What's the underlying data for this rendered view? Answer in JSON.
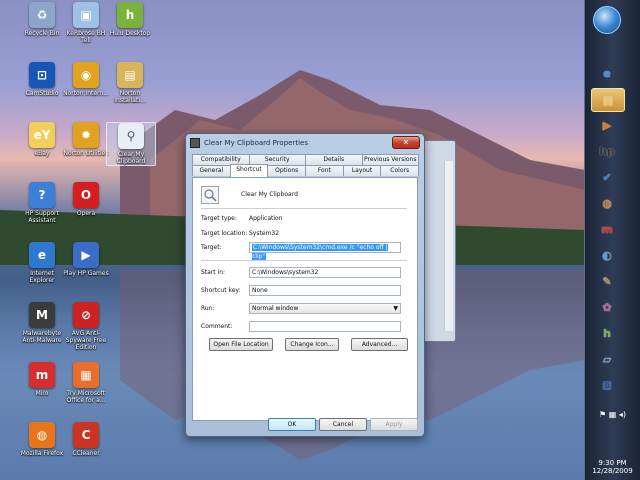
{
  "desktop_icons": [
    {
      "name": "recycle-bin",
      "label": "Recycle Bin",
      "icon": "recycle-icon",
      "color": "#8ba6c9",
      "glyph": "♻"
    },
    {
      "name": "kerbrose",
      "label": "KeRbrose BH Tell",
      "icon": "cube-icon",
      "color": "#9fc1e6",
      "glyph": "▣"
    },
    {
      "name": "hulu",
      "label": "Hulu Desktop",
      "icon": "hulu-icon",
      "color": "#79b33b",
      "glyph": "h"
    },
    {
      "name": "camstudio",
      "label": "CamStudio",
      "icon": "camstudio-icon",
      "color": "#1656b5",
      "glyph": "⊡"
    },
    {
      "name": "norton-internet",
      "label": "Norton Intern...",
      "icon": "norton-globe-icon",
      "color": "#e1a21f",
      "glyph": "◉"
    },
    {
      "name": "norton-install",
      "label": "Norton Installati...",
      "icon": "folder-icon",
      "color": "#d8b45a",
      "glyph": "▤"
    },
    {
      "name": "ebay",
      "label": "eBay",
      "icon": "ebay-icon",
      "color": "#f2cf5a",
      "glyph": "eY"
    },
    {
      "name": "norton-utilities",
      "label": "Norton Utilities",
      "icon": "norton-utilities-icon",
      "color": "#e1a21f",
      "glyph": "✹"
    },
    {
      "name": "clear-clipboard",
      "label": "Clear My Clipboard",
      "icon": "magnifier-icon",
      "color": "#e8eef5",
      "glyph": "⚲"
    },
    {
      "name": "hp-support",
      "label": "HP Support Assistant",
      "icon": "hp-support-icon",
      "color": "#3c7fd6",
      "glyph": "?"
    },
    {
      "name": "opera",
      "label": "Opera",
      "icon": "opera-icon",
      "color": "#d41f1f",
      "glyph": "O"
    },
    {
      "name": "internet-explorer",
      "label": "Internet Explorer",
      "icon": "ie-icon",
      "color": "#2f78d0",
      "glyph": "e"
    },
    {
      "name": "play-hp-games",
      "label": "Play HP Games",
      "icon": "games-icon",
      "color": "#3a6cc9",
      "glyph": "▶"
    },
    {
      "name": "malwarebytes",
      "label": "Malwarebyte Anti-Malware",
      "icon": "malwarebytes-icon",
      "color": "#3b3b3b",
      "glyph": "M"
    },
    {
      "name": "spybot",
      "label": "AVG Anti-Spyware Free Edition",
      "icon": "no-entry-icon",
      "color": "#cc2222",
      "glyph": "⊘"
    },
    {
      "name": "miro",
      "label": "Miro",
      "icon": "miro-icon",
      "color": "#d52e2e",
      "glyph": "m"
    },
    {
      "name": "try-office",
      "label": "Try Microsoft Office for a...",
      "icon": "office-icon",
      "color": "#e96e2b",
      "glyph": "▦"
    },
    {
      "name": "firefox",
      "label": "Mozilla Firefox",
      "icon": "firefox-icon",
      "color": "#e8751a",
      "glyph": "◍"
    },
    {
      "name": "ccleaner",
      "label": "CCleaner",
      "icon": "ccleaner-icon",
      "color": "#cc3322",
      "glyph": "C"
    }
  ],
  "dialog": {
    "title": "Clear My Clipboard Properties",
    "close_glyph": "✕",
    "tabs_row1": [
      "Compatibility",
      "Security",
      "Details",
      "Previous Versions"
    ],
    "tabs_row2": [
      "General",
      "Shortcut",
      "Options",
      "Font",
      "Layout",
      "Colors"
    ],
    "active_tab": "Shortcut",
    "shortcut_name": "Clear My Clipboard",
    "target_type_label": "Target type:",
    "target_type_value": "Application",
    "target_location_label": "Target location:",
    "target_location_value": "System32",
    "target_label": "Target:",
    "target_value": "C:\\Windows\\System32\\cmd.exe /c \"echo off | clip\"",
    "start_in_label": "Start in:",
    "start_in_value": "C:\\Windows\\system32",
    "shortcut_key_label": "Shortcut key:",
    "shortcut_key_value": "None",
    "run_label": "Run:",
    "run_value": "Normal window",
    "comment_label": "Comment:",
    "comment_value": "",
    "open_file_location": "Open File Location",
    "change_icon": "Change Icon...",
    "advanced": "Advanced...",
    "ok": "OK",
    "cancel": "Cancel",
    "apply": "Apply"
  },
  "taskbar": {
    "buttons": [
      {
        "name": "ie-taskbar",
        "icon": "ie-icon",
        "glyph": "e",
        "color": "#3a8ee6"
      },
      {
        "name": "folder-taskbar",
        "icon": "folder-icon",
        "glyph": "▤",
        "color": "#e2c66a"
      },
      {
        "name": "media-taskbar",
        "icon": "media-player-icon",
        "glyph": "▶",
        "color": "#e07a2a"
      },
      {
        "name": "hp-taskbar",
        "icon": "hp-icon",
        "glyph": "hp",
        "color": "#333"
      },
      {
        "name": "check-taskbar",
        "icon": "check-icon",
        "glyph": "✔",
        "color": "#3a7bd0"
      },
      {
        "name": "firefox-taskbar",
        "icon": "firefox-icon",
        "glyph": "◍",
        "color": "#e8751a"
      },
      {
        "name": "miro-taskbar",
        "icon": "miro-icon",
        "glyph": "m",
        "color": "#d52e2e"
      },
      {
        "name": "app-taskbar",
        "icon": "app-icon",
        "glyph": "◐",
        "color": "#5aa0d8"
      },
      {
        "name": "tools-taskbar",
        "icon": "tools-icon",
        "glyph": "✎",
        "color": "#c98e3a"
      },
      {
        "name": "pinwheel-taskbar",
        "icon": "pinwheel-icon",
        "glyph": "✿",
        "color": "#c45a9a"
      },
      {
        "name": "hulu-taskbar",
        "icon": "hulu-icon",
        "glyph": "h",
        "color": "#79b33b"
      },
      {
        "name": "document-taskbar",
        "icon": "document-icon",
        "glyph": "▱",
        "color": "#7fb0d8"
      },
      {
        "name": "camstudio-taskbar",
        "icon": "camstudio-icon",
        "glyph": "⊡",
        "color": "#1656b5"
      }
    ],
    "time": "9:30 PM",
    "date": "12/28/2009"
  }
}
